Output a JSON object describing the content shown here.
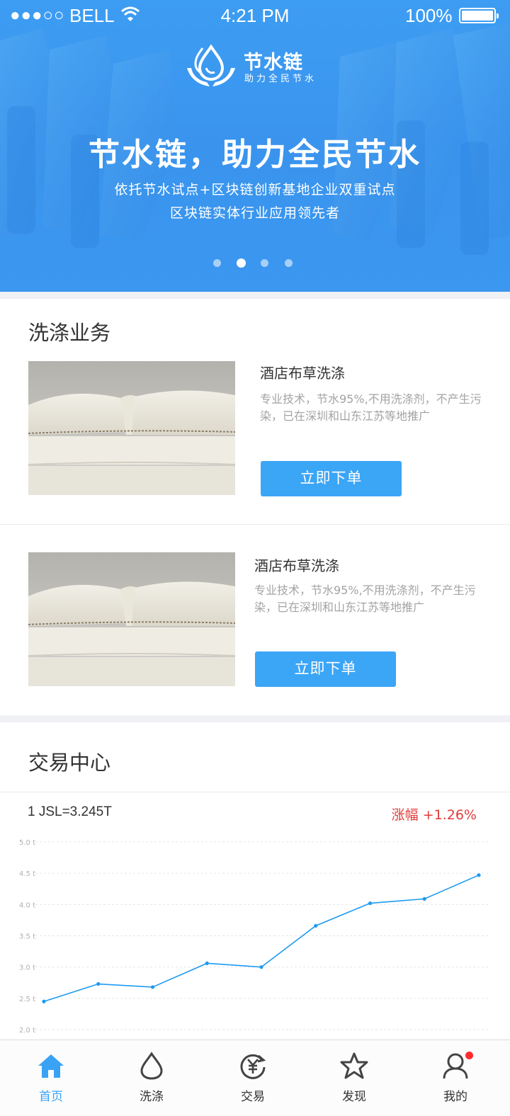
{
  "status_bar": {
    "carrier": "BELL",
    "time": "4:21 PM",
    "battery": "100%"
  },
  "banner": {
    "brand": "节水链",
    "slogan": "助力全民节水",
    "title": "节水链，助力全民节水",
    "subtitle_line1": "依托节水试点+区块链创新基地企业双重试点",
    "subtitle_line2": "区块链实体行业应用领先者",
    "active_slide": 1
  },
  "washing": {
    "section_title": "洗涤业务",
    "items": [
      {
        "name": "酒店布草洗涤",
        "desc": "专业技术，节水95%,不用洗涤剂，不产生污染，已在深圳和山东江苏等地推广",
        "button": "立即下单"
      },
      {
        "name": "酒店布草洗涤",
        "desc": "专业技术，节水95%,不用洗涤剂，不产生污染，已在深圳和山东江苏等地推广",
        "button": "立即下单"
      }
    ]
  },
  "trade": {
    "section_title": "交易中心",
    "rate": "1 JSL=3.245T",
    "change": "涨幅 +1.26%"
  },
  "chart_data": {
    "type": "line",
    "title": "",
    "xlabel": "",
    "ylabel": "",
    "ylim": [
      2.0,
      5.0
    ],
    "y_ticks": [
      "5.0 t",
      "4.5 t",
      "4.0 t",
      "3.5 t",
      "3.0 t",
      "2.5 t",
      "2.0 t"
    ],
    "grid": true,
    "series": [
      {
        "values": [
          2.45,
          2.73,
          2.68,
          3.06,
          3.0,
          3.66,
          4.02,
          4.09,
          4.47
        ],
        "color": "#1e9bf0"
      }
    ]
  },
  "tabbar": {
    "items": [
      {
        "label": "首页",
        "icon": "home-icon"
      },
      {
        "label": "洗涤",
        "icon": "water-drop-icon"
      },
      {
        "label": "交易",
        "icon": "yuan-exchange-icon"
      },
      {
        "label": "发现",
        "icon": "star-icon"
      },
      {
        "label": "我的",
        "icon": "user-icon"
      }
    ],
    "active_index": 0
  },
  "colors": {
    "primary": "#3ba5f6",
    "banner": "#3a94ee",
    "rise": "#e23b3b",
    "badge": "#ff2c2c"
  }
}
